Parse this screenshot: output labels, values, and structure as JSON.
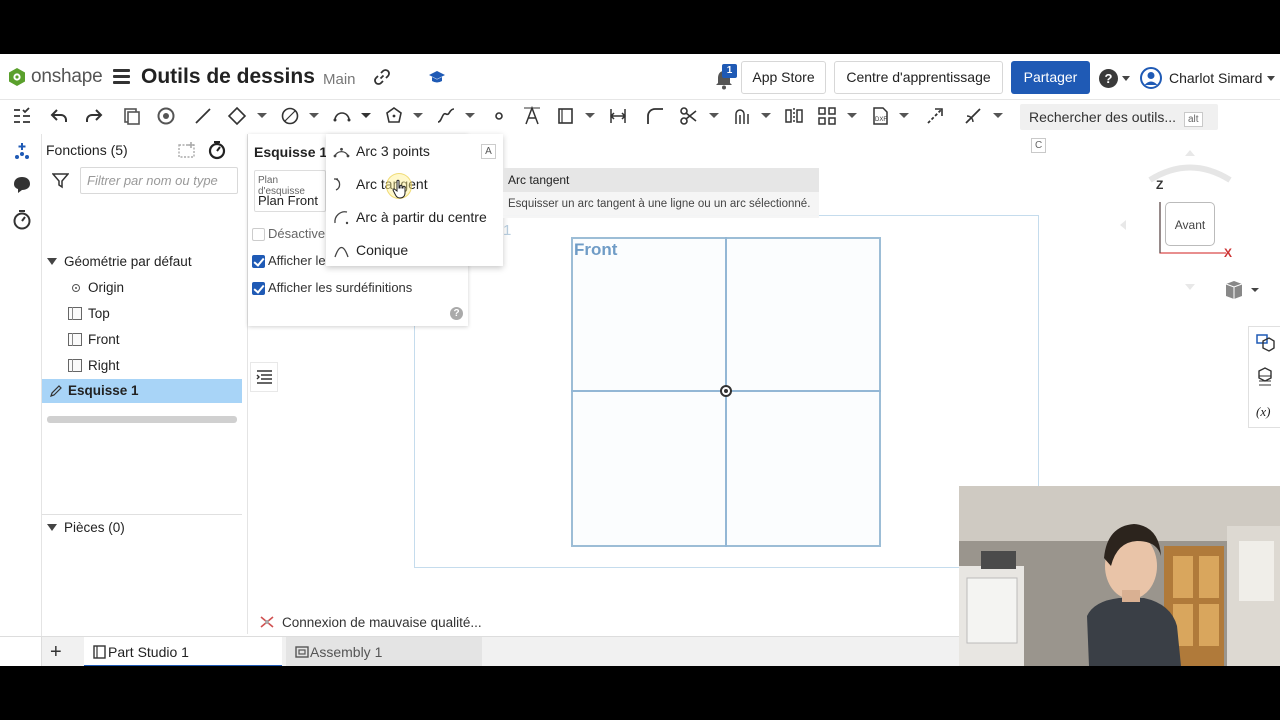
{
  "header": {
    "app_name": "onshape",
    "doc_title": "Outils de dessins",
    "branch": "Main",
    "notification_count": "1",
    "app_store": "App Store",
    "learning_center": "Centre d'apprentissage",
    "share": "Partager",
    "help": "?",
    "user_name": "Charlot Simard"
  },
  "toolbar": {
    "search_placeholder": "Rechercher des outils...",
    "search_shortcut_1": "alt",
    "search_shortcut_2": "C"
  },
  "feature_panel": {
    "title": "Fonctions (5)",
    "filter_placeholder": "Filtrer par nom ou type",
    "default_geometry": "Géométrie par défaut",
    "items": [
      {
        "label": "Origin"
      },
      {
        "label": "Top"
      },
      {
        "label": "Front"
      },
      {
        "label": "Right"
      }
    ],
    "sketch_item": "Esquisse 1",
    "parts": "Pièces (0)"
  },
  "sketch_dialog": {
    "title": "Esquisse 1",
    "plane_label": "Plan d'esquisse",
    "plane_value": "Plan Front",
    "option_disable": "Désactiver",
    "option_show": "Afficher le",
    "option_overdefined": "Afficher les surdéfinitions"
  },
  "arc_menu": {
    "items": [
      {
        "label": "Arc 3 points",
        "shortcut": "A"
      },
      {
        "label": "Arc tangent"
      },
      {
        "label": "Arc à partir du centre"
      },
      {
        "label": "Conique"
      }
    ]
  },
  "tooltip": {
    "title": "Arc tangent",
    "description": "Esquisser un arc tangent à une ligne ou un arc sélectionné."
  },
  "canvas": {
    "plane_name": "Front",
    "ghost_label": "1",
    "view_cube_face": "Avant",
    "axis_z": "Z",
    "axis_x": "X"
  },
  "status": {
    "message": "Connexion de mauvaise qualité..."
  },
  "tabs": [
    {
      "label": "Part Studio 1",
      "active": true
    },
    {
      "label": "Assembly 1",
      "active": false
    }
  ],
  "colors": {
    "accent": "#1f5ab5",
    "selected_row": "#a8d4f7",
    "plane_blue": "#6f9cc6"
  }
}
